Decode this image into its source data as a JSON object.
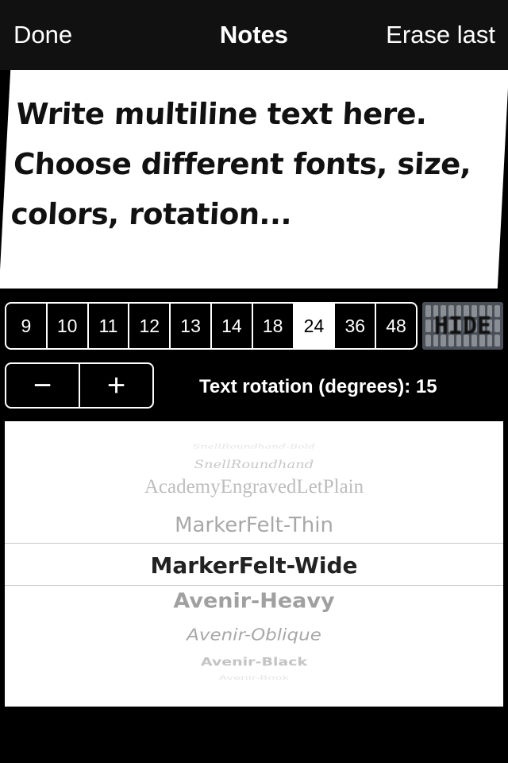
{
  "nav": {
    "done": "Done",
    "title": "Notes",
    "erase": "Erase last"
  },
  "editor": {
    "text": "Write multiline text here.\nChoose different fonts, size,\ncolors, rotation..."
  },
  "sizes": {
    "options": [
      "9",
      "10",
      "11",
      "12",
      "13",
      "14",
      "18",
      "24",
      "36",
      "48"
    ],
    "selected": "24"
  },
  "hide_keyboard": {
    "label": "HIDE"
  },
  "stepper": {
    "minus": "−",
    "plus": "+"
  },
  "rotation": {
    "label": "Text rotation (degrees): 15"
  },
  "font_picker": {
    "items": [
      "SnellRoundhand-Bold",
      "SnellRoundhand",
      "AcademyEngravedLetPlain",
      "MarkerFelt-Thin",
      "MarkerFelt-Wide",
      "Avenir-Heavy",
      "Avenir-Oblique",
      "Avenir-Black",
      "Avenir-Book"
    ],
    "selected": "MarkerFelt-Wide"
  }
}
